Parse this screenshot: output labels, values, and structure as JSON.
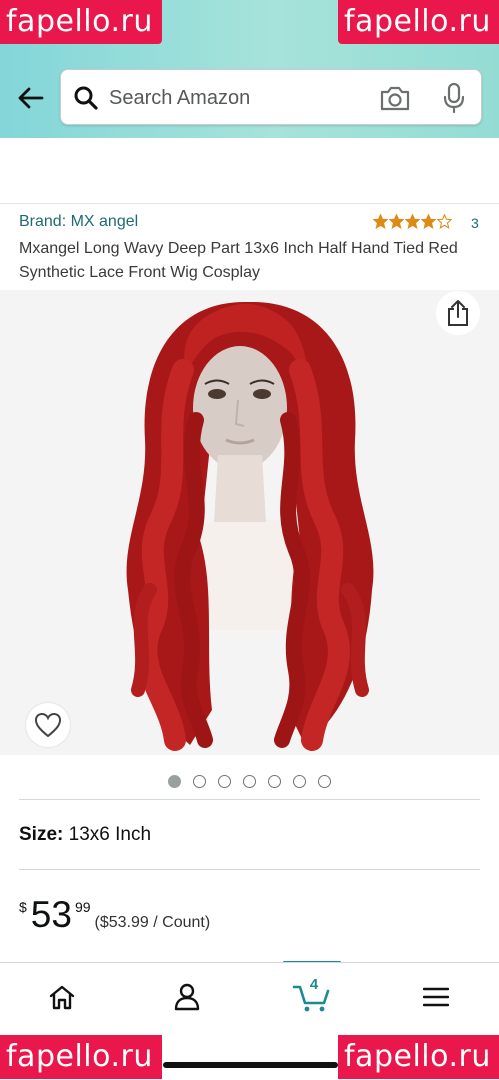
{
  "watermark": {
    "text": "fapello.ru"
  },
  "search": {
    "placeholder": "Search Amazon"
  },
  "product": {
    "brand": "Brand: MX angel",
    "rating_count": "3",
    "rating": 4,
    "rating_max": 5,
    "title": "Mxangel Long Wavy Deep Part 13x6 Inch Half Hand Tied Red Synthetic Lace Front Wig Cosplay"
  },
  "carousel": {
    "total": 7,
    "active_index": 0
  },
  "size": {
    "label": "Size:",
    "value": "13x6 Inch"
  },
  "price": {
    "symbol": "$",
    "whole": "53",
    "fraction": "99",
    "per_unit": "($53.99 / Count)"
  },
  "nav": {
    "cart_count": "4"
  },
  "colors": {
    "header_accent": "#83d6d9",
    "brand_link": "#1f6a75",
    "star": "#de8b16",
    "cart_accent": "#1d8a8f",
    "wig_red": "#b71c1c",
    "watermark": "#e9174b"
  },
  "icons": [
    "back-arrow-icon",
    "search-icon",
    "camera-icon",
    "microphone-icon",
    "share-icon",
    "heart-icon",
    "home-icon",
    "account-icon",
    "cart-icon",
    "menu-icon"
  ]
}
